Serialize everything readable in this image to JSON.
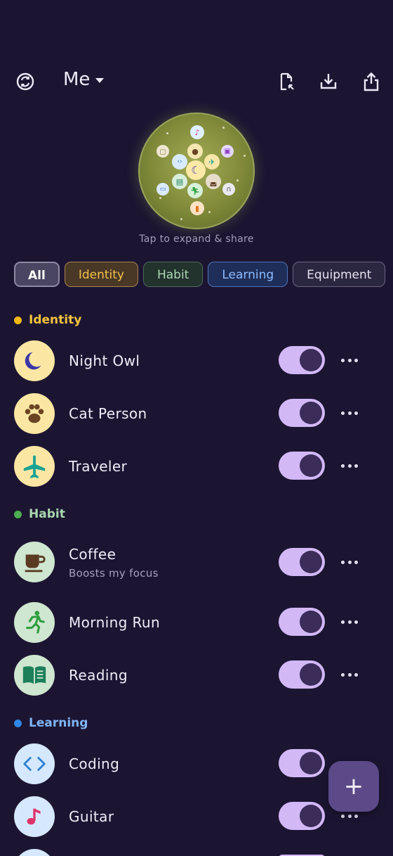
{
  "header": {
    "profile_label": "Me",
    "icons": [
      "sync-icon",
      "export-file-icon",
      "download-icon",
      "share-icon"
    ]
  },
  "globe": {
    "caption": "Tap to expand & share"
  },
  "filters": [
    {
      "label": "All",
      "active": true
    },
    {
      "label": "Identity",
      "active": false
    },
    {
      "label": "Habit",
      "active": false
    },
    {
      "label": "Learning",
      "active": false
    },
    {
      "label": "Equipment",
      "active": false
    }
  ],
  "sections": {
    "identity": {
      "label": "Identity",
      "color": "#f2b90f"
    },
    "habit": {
      "label": "Habit",
      "color": "#4caf50"
    },
    "learning": {
      "label": "Learning",
      "color": "#2e88e6"
    }
  },
  "items": {
    "night_owl": {
      "title": "Night Owl",
      "enabled": true,
      "icon": "moon-icon"
    },
    "cat_person": {
      "title": "Cat Person",
      "enabled": true,
      "icon": "paw-icon"
    },
    "traveler": {
      "title": "Traveler",
      "enabled": true,
      "icon": "airplane-icon"
    },
    "coffee": {
      "title": "Coffee",
      "subtitle": "Boosts my focus",
      "enabled": true,
      "icon": "coffee-icon"
    },
    "morning_run": {
      "title": "Morning Run",
      "enabled": true,
      "icon": "runner-icon"
    },
    "reading": {
      "title": "Reading",
      "enabled": true,
      "icon": "book-icon"
    },
    "coding": {
      "title": "Coding",
      "enabled": true,
      "icon": "code-icon"
    },
    "guitar": {
      "title": "Guitar",
      "enabled": true,
      "icon": "music-note-icon"
    }
  },
  "fab": {
    "label": "+"
  }
}
